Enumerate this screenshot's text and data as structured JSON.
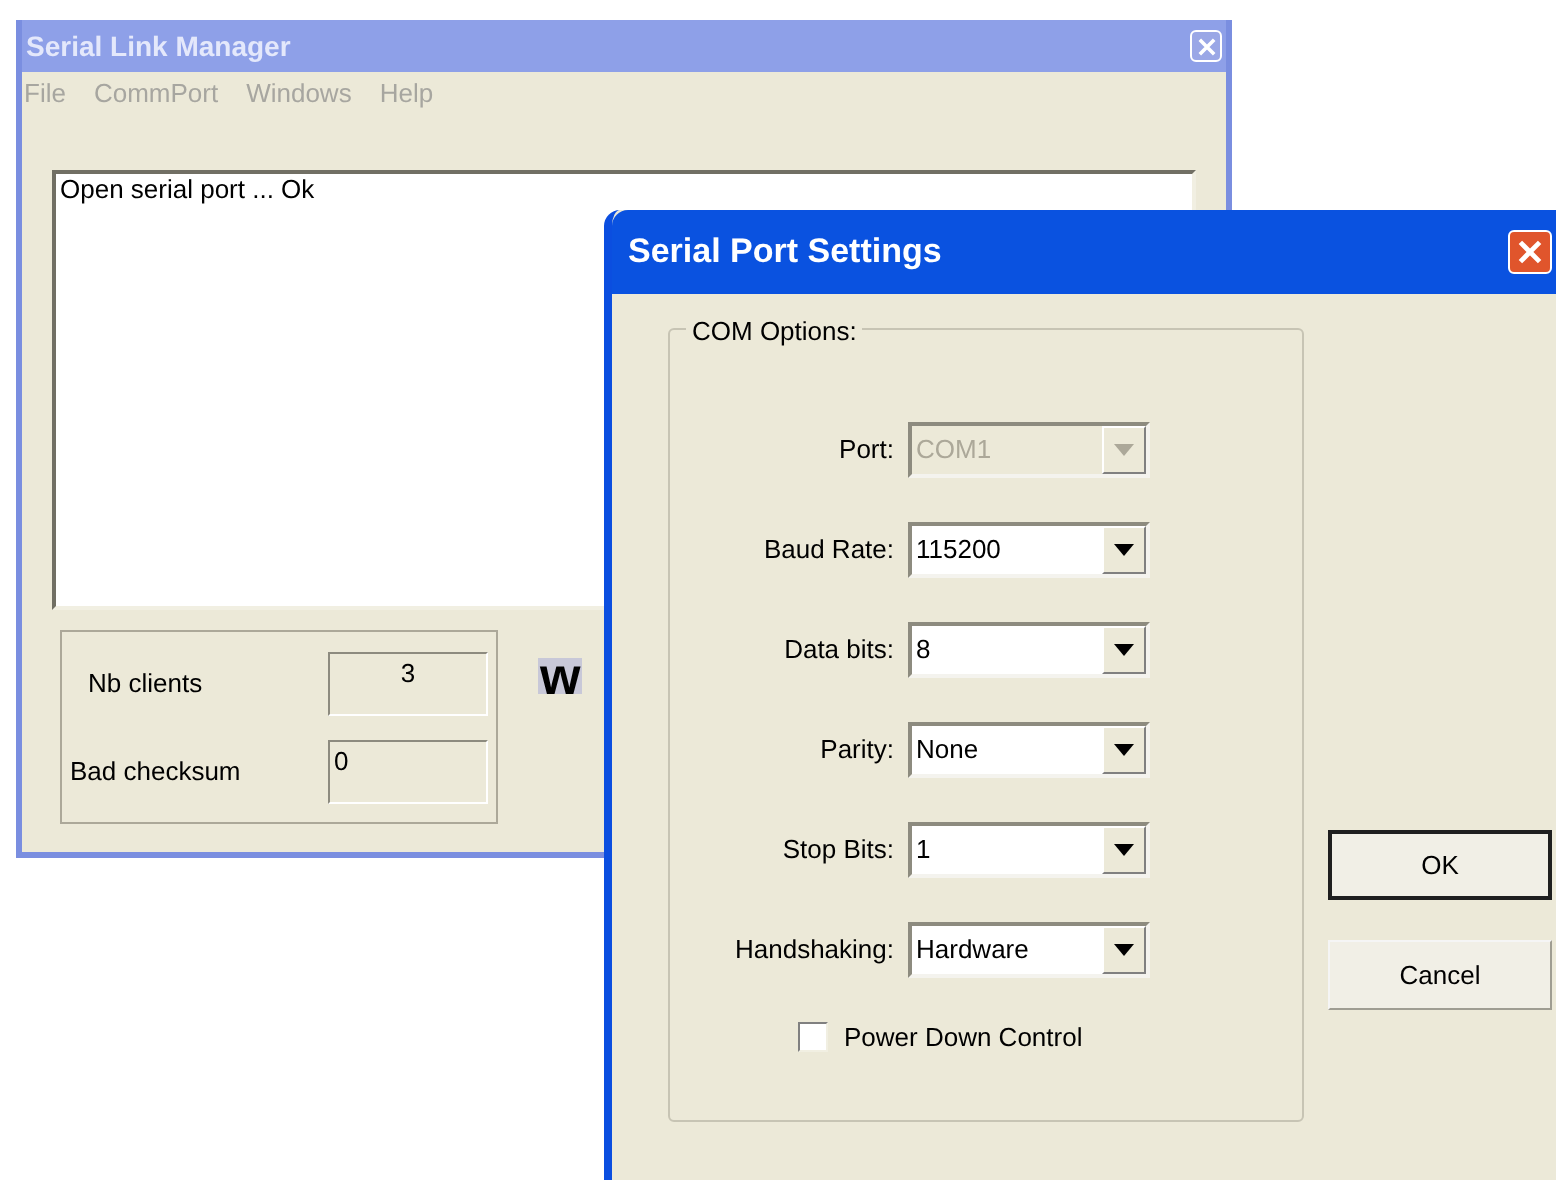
{
  "main_window": {
    "title": "Serial Link Manager",
    "active": false,
    "menu": [
      "File",
      "CommPort",
      "Windows",
      "Help"
    ],
    "log": [
      "Open serial port ... Ok"
    ],
    "stats": [
      {
        "label": "Nb clients",
        "value": "3",
        "centered": true
      },
      {
        "label": "Bad checksum",
        "value": "0",
        "centered": false
      }
    ],
    "logo_text": "w"
  },
  "dialog": {
    "title": "Serial Port Settings",
    "active": true,
    "group_title": "COM Options:",
    "fields": [
      {
        "label": "Port:",
        "value": "COM1",
        "disabled": true
      },
      {
        "label": "Baud Rate:",
        "value": "115200",
        "disabled": false
      },
      {
        "label": "Data bits:",
        "value": "8",
        "disabled": false
      },
      {
        "label": "Parity:",
        "value": "None",
        "disabled": false
      },
      {
        "label": "Stop Bits:",
        "value": "1",
        "disabled": false
      },
      {
        "label": "Handshaking:",
        "value": "Hardware",
        "disabled": false
      }
    ],
    "checkbox": {
      "label": "Power Down Control",
      "checked": false
    },
    "buttons": [
      {
        "label": "OK",
        "default": true
      },
      {
        "label": "Cancel",
        "default": false
      }
    ]
  }
}
